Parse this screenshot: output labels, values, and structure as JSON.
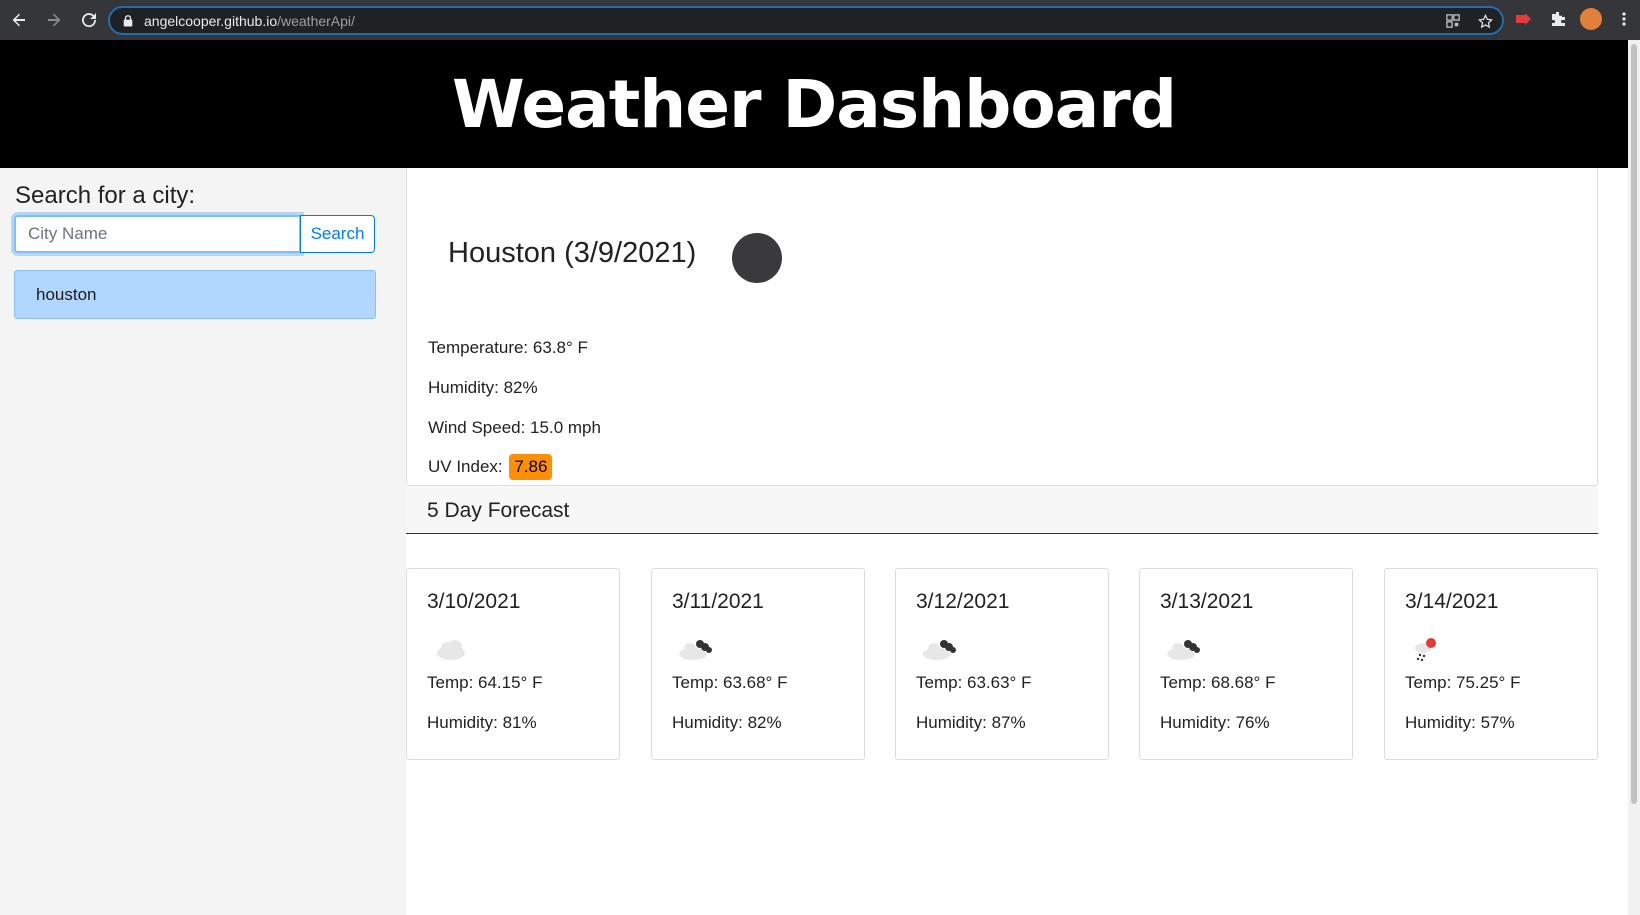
{
  "browser": {
    "url_host": "angelcooper.github.io",
    "url_path": "/weatherApi/"
  },
  "header": {
    "title": "Weather Dashboard"
  },
  "sidebar": {
    "search_label": "Search for a city:",
    "input_placeholder": "City Name",
    "input_value": "",
    "search_button": "Search",
    "history": [
      {
        "label": "houston"
      }
    ]
  },
  "current": {
    "city_title": "Houston (3/9/2021)",
    "icon": "night-clear-icon",
    "temperature": "Temperature: 63.8° F",
    "humidity": "Humidity: 82%",
    "wind": "Wind Speed: 15.0 mph",
    "uv_label": "UV Index: ",
    "uv_value": "7.86",
    "uv_color": "#ff8f00"
  },
  "forecast": {
    "heading": "5 Day Forecast",
    "days": [
      {
        "date": "3/10/2021",
        "icon": "cloud-icon",
        "temp": "Temp: 64.15° F",
        "humidity": "Humidity: 81%"
      },
      {
        "date": "3/11/2021",
        "icon": "broken-clouds-icon",
        "temp": "Temp: 63.68° F",
        "humidity": "Humidity: 82%"
      },
      {
        "date": "3/12/2021",
        "icon": "broken-clouds-icon",
        "temp": "Temp: 63.63° F",
        "humidity": "Humidity: 87%"
      },
      {
        "date": "3/13/2021",
        "icon": "broken-clouds-icon",
        "temp": "Temp: 68.68° F",
        "humidity": "Humidity: 76%"
      },
      {
        "date": "3/14/2021",
        "icon": "rain-icon",
        "temp": "Temp: 75.25° F",
        "humidity": "Humidity: 57%"
      }
    ]
  }
}
